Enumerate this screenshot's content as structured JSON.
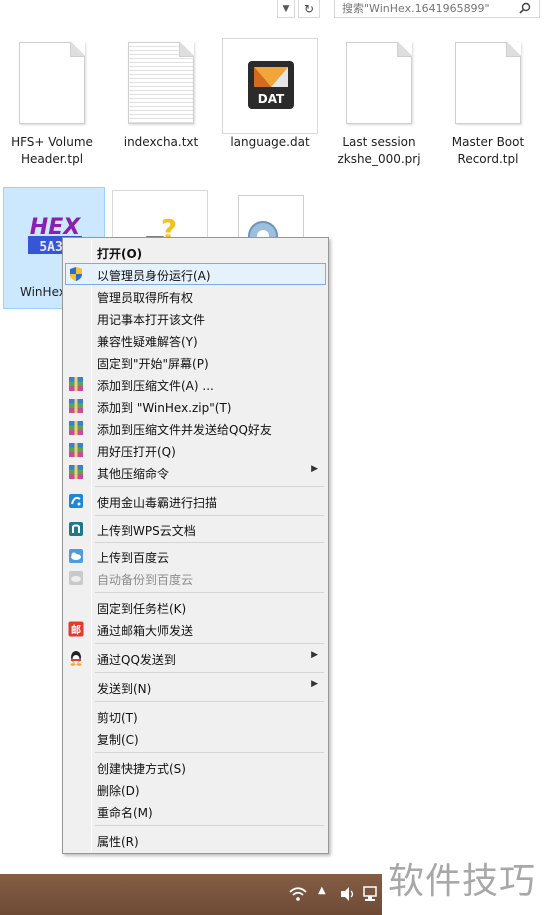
{
  "toolbar": {
    "search_placeholder": "搜索\"WinHex.1641965899\""
  },
  "files": [
    {
      "name": "HFS+ Volume\nHeader.tpl"
    },
    {
      "name": "indexcha.txt"
    },
    {
      "name": "language.dat",
      "icon_text": "DAT"
    },
    {
      "name": "Last session\nzkshe_000.prj"
    },
    {
      "name": "Master Boot\nRecord.tpl"
    },
    {
      "name": "WinHex",
      "icon_text": "HEX"
    }
  ],
  "menu": {
    "items": [
      {
        "label": "打开(O)"
      },
      {
        "label": "以管理员身份运行(A)"
      },
      {
        "label": "管理员取得所有权"
      },
      {
        "label": "用记事本打开该文件"
      },
      {
        "label": "兼容性疑难解答(Y)"
      },
      {
        "label": "固定到\"开始\"屏幕(P)"
      },
      {
        "label": "添加到压缩文件(A) ..."
      },
      {
        "label": "添加到 \"WinHex.zip\"(T)"
      },
      {
        "label": "添加到压缩文件并发送给QQ好友"
      },
      {
        "label": "用好压打开(Q)"
      },
      {
        "label": "其他压缩命令"
      },
      {
        "label": "使用金山毒霸进行扫描"
      },
      {
        "label": "上传到WPS云文档"
      },
      {
        "label": "上传到百度云"
      },
      {
        "label": "自动备份到百度云"
      },
      {
        "label": "固定到任务栏(K)"
      },
      {
        "label": "通过邮箱大师发送"
      },
      {
        "label": "通过QQ发送到"
      },
      {
        "label": "发送到(N)"
      },
      {
        "label": "剪切(T)"
      },
      {
        "label": "复制(C)"
      },
      {
        "label": "创建快捷方式(S)"
      },
      {
        "label": "删除(D)"
      },
      {
        "label": "重命名(M)"
      },
      {
        "label": "属性(R)"
      }
    ],
    "mail_icon_text": "邮"
  },
  "watermark": "软件技巧",
  "colors": {
    "selection": "#cce8ff",
    "menu_bg": "#f0f0f0",
    "taskbar": "#7a5440",
    "highlight": "#e5f1fb"
  }
}
